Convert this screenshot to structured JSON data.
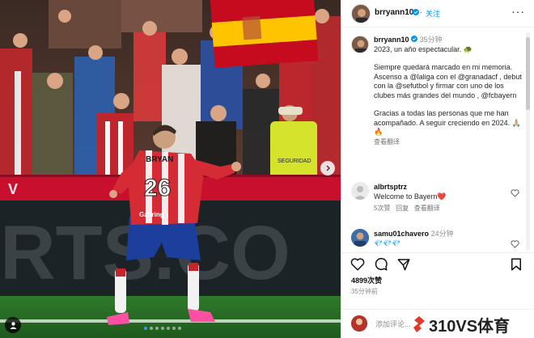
{
  "post": {
    "username": "brryann10",
    "follow_label": "关注",
    "caption_time": "35分钟",
    "caption_lines": [
      "2023, un año espectacular. 🐢",
      "Siempre quedará marcado en mi memoria. Ascenso a @laliga con el @granadacf , debut con la @sefutbol y firmar con uno de los clubes más grandes del mundo , @fcbayern",
      "Gracias a todas las personas que me han acompañado. A seguir creciendo en 2024. 🙏🏼🔥"
    ],
    "translate_label": "查看翻译",
    "likes": "4899次赞",
    "posted_ago": "35分钟前",
    "add_comment_placeholder": "添加评论...",
    "photo": {
      "jersey_name": "BRYAN",
      "jersey_number": "26",
      "sponsor": "Gabring",
      "board_text": "RTS.CO",
      "steward_text": "SEGURIDAD"
    }
  },
  "comments": [
    {
      "username": "albrtsptrz",
      "text": "Welcome to Bayern❤️",
      "likes": "5次赞",
      "reply_label": "回复",
      "translate_label": "查看翻译"
    },
    {
      "username": "samu01chavero",
      "time": "24分钟",
      "text": "💎💎💎"
    }
  ],
  "watermark": {
    "text": "310VS体育",
    "color": "#e03a2c"
  },
  "colors": {
    "link": "#0095f6",
    "mention": "#00376b",
    "granada_red": "#c8102e"
  },
  "icons": [
    "more-icon",
    "verified-icon",
    "heart-icon",
    "comment-icon",
    "share-icon",
    "bookmark-icon",
    "chevron-right-icon",
    "user-tag-icon"
  ]
}
